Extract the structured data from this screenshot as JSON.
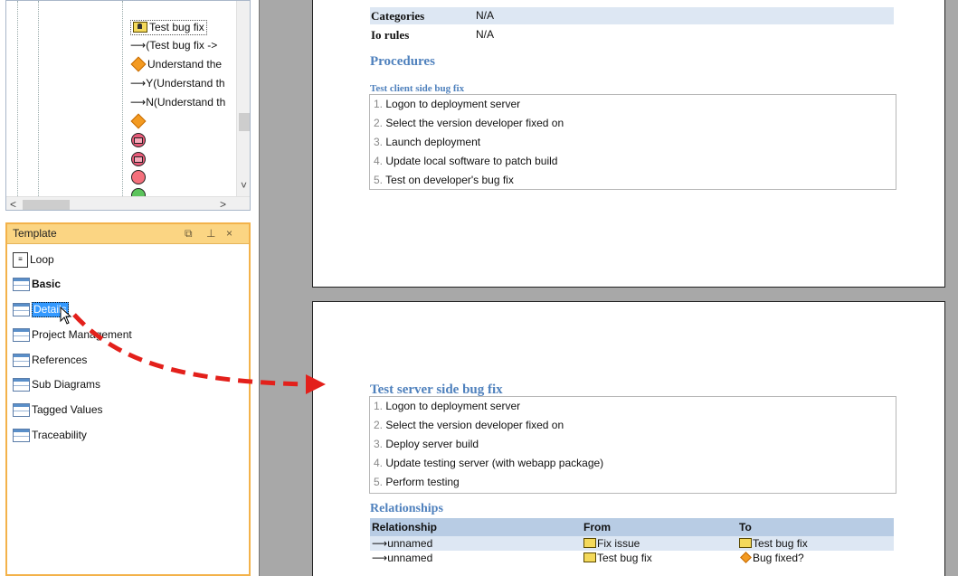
{
  "tree": {
    "items": [
      {
        "icon": "box",
        "label": "Test bug fix",
        "selected": true
      },
      {
        "icon": "arrow",
        "label": "(Test bug fix ->"
      },
      {
        "icon": "diamond",
        "label": "Understand the"
      },
      {
        "icon": "arrow",
        "label": "Y(Understand th"
      },
      {
        "icon": "arrow",
        "label": "N(Understand th"
      },
      {
        "icon": "diamond",
        "label": ""
      },
      {
        "icon": "message-circle",
        "label": ""
      },
      {
        "icon": "message-circle",
        "label": ""
      },
      {
        "icon": "circle",
        "label": ""
      },
      {
        "icon": "green-circle",
        "label": ""
      }
    ],
    "scroll_left": "<",
    "scroll_right": ">",
    "scroll_down": "˅"
  },
  "template": {
    "title": "Template",
    "buttons": {
      "restore": "⧉",
      "pin": "⊥",
      "close": "×"
    },
    "items": [
      {
        "icon": "loop",
        "label": "Loop"
      },
      {
        "icon": "table",
        "label": "Basic",
        "bold": true
      },
      {
        "icon": "table",
        "label": "Details",
        "selected": true
      },
      {
        "icon": "table",
        "label": "Project Management"
      },
      {
        "icon": "table",
        "label": "References"
      },
      {
        "icon": "table",
        "label": "Sub Diagrams"
      },
      {
        "icon": "table",
        "label": "Tagged Values"
      },
      {
        "icon": "table",
        "label": "Traceability"
      }
    ]
  },
  "page1": {
    "rows": [
      {
        "key": "Categories",
        "value": "N/A"
      },
      {
        "key": "Io rules",
        "value": "N/A"
      }
    ],
    "procedures_heading": "Procedures",
    "procedure_title": "Test client side bug fix",
    "steps": [
      {
        "num": "1.",
        "text": "Logon to deployment server"
      },
      {
        "num": "2.",
        "text": "Select the version developer fixed on"
      },
      {
        "num": "3.",
        "text": "Launch deployment"
      },
      {
        "num": "4.",
        "text": "Update local software to patch build"
      },
      {
        "num": "5.",
        "text": "Test on developer's bug fix"
      }
    ]
  },
  "page2": {
    "procedure_title": "Test server side bug fix",
    "steps": [
      {
        "num": "1.",
        "text": "Logon to deployment server"
      },
      {
        "num": "2.",
        "text": "Select the version developer fixed on"
      },
      {
        "num": "3.",
        "text": "Deploy server build"
      },
      {
        "num": "4.",
        "text": "Update testing server (with webapp package)"
      },
      {
        "num": "5.",
        "text": "Perform testing"
      }
    ],
    "relationships_heading": "Relationships",
    "columns": [
      "Relationship",
      "From",
      "To"
    ],
    "relationships": [
      {
        "relationship": "unnamed",
        "from": "Fix issue",
        "from_icon": "box",
        "to": "Test bug fix",
        "to_icon": "box"
      },
      {
        "relationship": "unnamed",
        "from": "Test bug fix",
        "from_icon": "box",
        "to": "Bug fixed?",
        "to_icon": "diamond"
      }
    ]
  },
  "colors": {
    "accent_heading": "#4f81bd",
    "template_header": "#fbd583",
    "selection": "#3399ff",
    "drag_arrow": "#e3201b"
  }
}
